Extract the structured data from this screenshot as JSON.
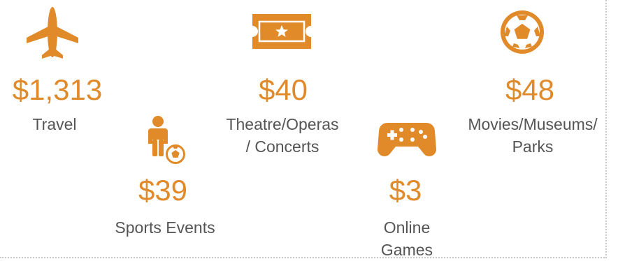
{
  "accent_color": "#E08A2A",
  "items": [
    {
      "icon": "airplane-icon",
      "amount": "$1,313",
      "label_lines": [
        "Travel"
      ]
    },
    {
      "icon": "ticket-icon",
      "amount": "$40",
      "label_lines": [
        "Theatre/Operas",
        "/ Concerts"
      ]
    },
    {
      "icon": "soccer-ball-icon",
      "amount": "$48",
      "label_lines": [
        "Movies/Museums/",
        "Parks"
      ]
    },
    {
      "icon": "child-soccer-icon",
      "amount": "$39",
      "label_lines": [
        "Sports Events"
      ]
    },
    {
      "icon": "gamepad-icon",
      "amount": "$3",
      "label_lines": [
        "Online",
        "Games"
      ]
    }
  ]
}
